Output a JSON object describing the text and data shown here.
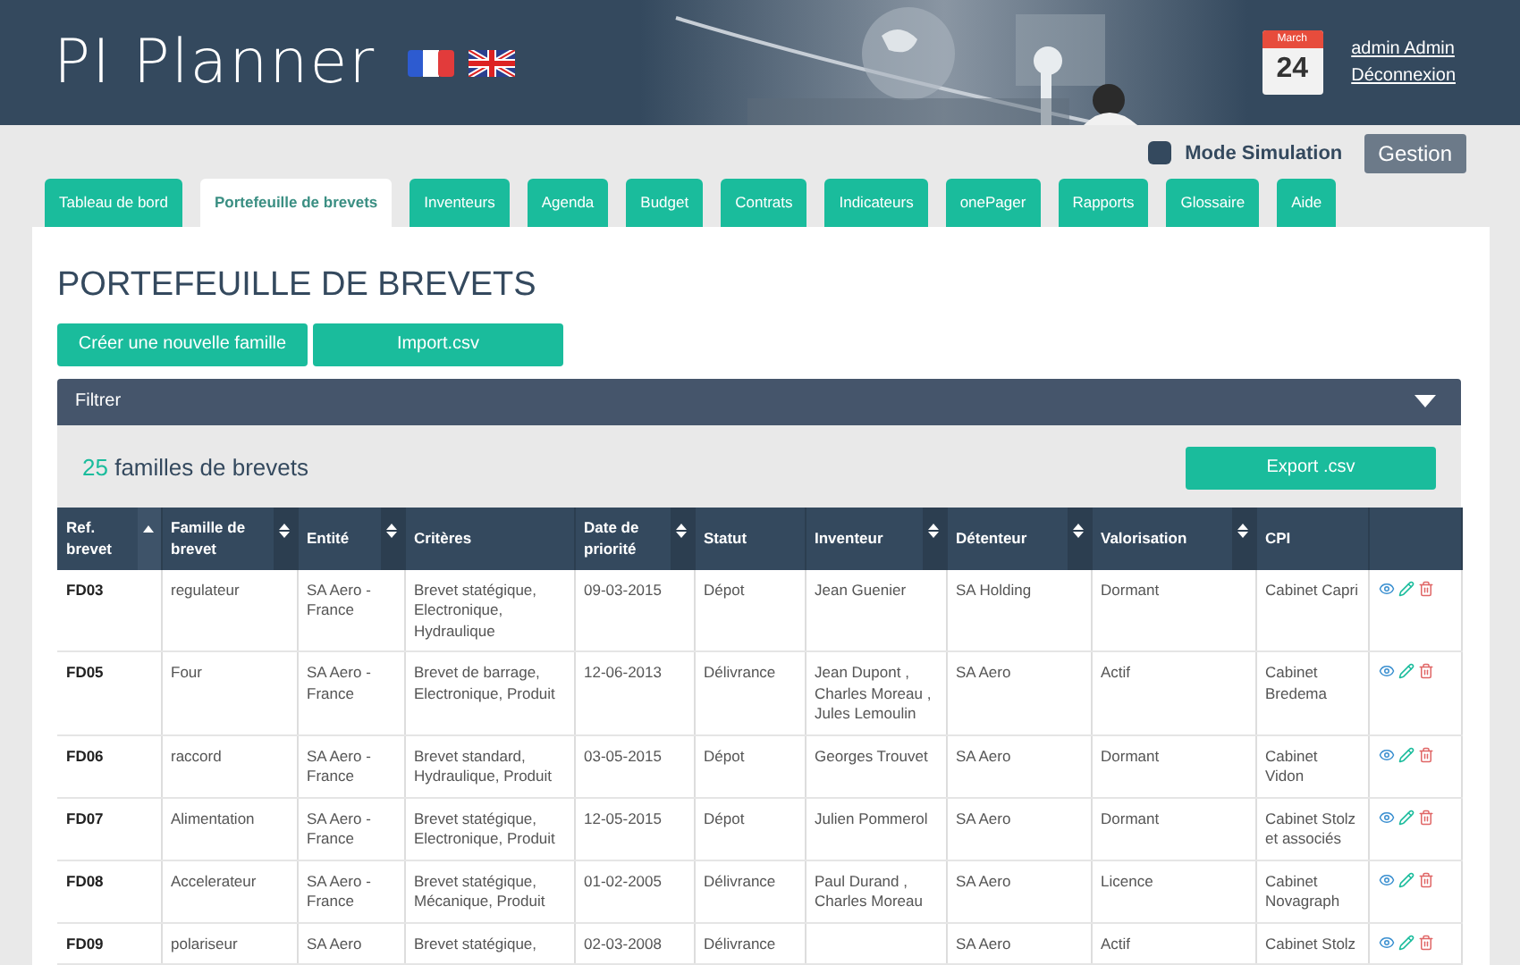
{
  "header": {
    "logo": "PI Planner",
    "calendar": {
      "month": "March",
      "day": "24"
    },
    "user_link": "admin Admin",
    "logout_link": "Déconnexion"
  },
  "toolbar": {
    "simulation": {
      "label": "Mode Simulation",
      "checked": false
    },
    "gestion_button": "Gestion"
  },
  "tabs": [
    {
      "label": "Tableau de bord",
      "selected": false
    },
    {
      "label": "Portefeuille de brevets",
      "selected": true
    },
    {
      "label": "Inventeurs",
      "selected": false
    },
    {
      "label": "Agenda",
      "selected": false
    },
    {
      "label": "Budget",
      "selected": false
    },
    {
      "label": "Contrats",
      "selected": false
    },
    {
      "label": "Indicateurs",
      "selected": false
    },
    {
      "label": "onePager",
      "selected": false
    },
    {
      "label": "Rapports",
      "selected": false
    },
    {
      "label": "Glossaire",
      "selected": false
    },
    {
      "label": "Aide",
      "selected": false
    }
  ],
  "page_title": "PORTEFEUILLE DE BREVETS",
  "actions": [
    "Créer une nouvelle famille",
    "Import.csv"
  ],
  "filter": {
    "label": "Filtrer",
    "expanded": false
  },
  "summary": {
    "count": "25",
    "text": "familles de brevets",
    "export_button": "Export .csv"
  },
  "table": {
    "columns": [
      {
        "label": "Ref. brevet",
        "sortable": true,
        "sorted": true
      },
      {
        "label": "Famille de brevet",
        "sortable": true,
        "sorted": false
      },
      {
        "label": "Entité",
        "sortable": true,
        "sorted": false
      },
      {
        "label": "Critères",
        "sortable": false
      },
      {
        "label": "Date de priorité",
        "sortable": true,
        "sorted": false
      },
      {
        "label": "Statut",
        "sortable": false
      },
      {
        "label": "Inventeur",
        "sortable": true,
        "sorted": false
      },
      {
        "label": "Détenteur",
        "sortable": true,
        "sorted": false
      },
      {
        "label": "Valorisation",
        "sortable": true,
        "sorted": false
      },
      {
        "label": "CPI",
        "sortable": false
      },
      {
        "sortable": false
      }
    ],
    "rows": [
      {
        "cells": [
          "FD03",
          "regulateur",
          "SA Aero -France",
          "Brevet statégique, Electronique, Hydraulique",
          "09-03-2015",
          "Dépot",
          "Jean Guenier",
          "SA Holding",
          "Dormant",
          "Cabinet Capri"
        ]
      },
      {
        "cells": [
          "FD05",
          "Four",
          "SA Aero -France",
          "Brevet de barrage, Electronique, Produit",
          "12-06-2013",
          "Délivrance",
          "Jean Dupont , Charles Moreau , Jules Lemoulin",
          "SA Aero",
          "Actif",
          "Cabinet Bredema"
        ]
      },
      {
        "cells": [
          "FD06",
          "raccord",
          "SA Aero -France",
          "Brevet standard, Hydraulique, Produit",
          "03-05-2015",
          "Dépot",
          "Georges Trouvet",
          "SA Aero",
          "Dormant",
          "Cabinet Vidon"
        ]
      },
      {
        "cells": [
          "FD07",
          "Alimentation",
          "SA Aero -France",
          "Brevet statégique, Electronique, Produit",
          "12-05-2015",
          "Dépot",
          "Julien Pommerol",
          "SA Aero",
          "Dormant",
          "Cabinet Stolz et associés"
        ]
      },
      {
        "cells": [
          "FD08",
          "Accelerateur",
          "SA Aero -France",
          "Brevet statégique, Mécanique, Produit",
          "01-02-2005",
          "Délivrance",
          "Paul Durand , Charles Moreau",
          "SA Aero",
          "Licence",
          "Cabinet Novagraph"
        ]
      },
      {
        "cells": [
          "FD09",
          "polariseur",
          "SA Aero",
          "Brevet statégique,",
          "02-03-2008",
          "Délivrance",
          "",
          "SA Aero",
          "Actif",
          "Cabinet Stolz"
        ]
      }
    ]
  }
}
